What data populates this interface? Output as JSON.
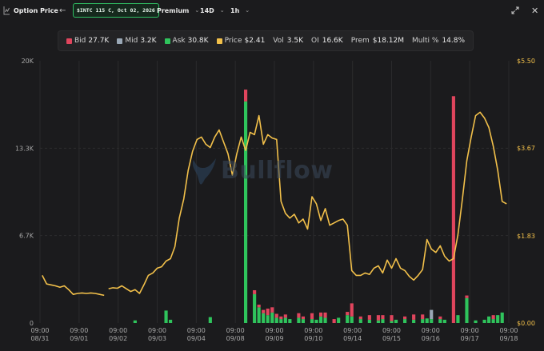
{
  "toolbar": {
    "title": "Option Price",
    "back_icon": "arrow-left-icon",
    "ticker": "$INTC 115 C, Oct 02, 2026",
    "dropdowns": [
      "Premium",
      "14D",
      "1h"
    ],
    "expand_icon": "expand-icon",
    "close_icon": "close-icon"
  },
  "legend": {
    "bid": {
      "label": "Bid",
      "value": "27.7K",
      "color": "#e0455d"
    },
    "mid": {
      "label": "Mid",
      "value": "3.2K",
      "color": "#9aa8b6"
    },
    "ask": {
      "label": "Ask",
      "value": "30.8K",
      "color": "#2fc45c"
    },
    "price": {
      "label": "Price",
      "value": "$2.41",
      "color": "#f2c04a"
    },
    "vol": {
      "label": "Vol",
      "value": "3.5K"
    },
    "oi": {
      "label": "OI",
      "value": "16.6K"
    },
    "prem": {
      "label": "Prem",
      "value": "$18.12M"
    },
    "multi": {
      "label": "Multi %",
      "value": "14.8%"
    }
  },
  "watermark": "Bullflow",
  "chart_data": {
    "type": "bar+line",
    "left_axis": {
      "ticks": [
        "20K",
        "13.3K",
        "6.7K",
        "0"
      ],
      "ylim": [
        0,
        20000
      ]
    },
    "right_axis": {
      "ticks": [
        "$5.50",
        "$3.67",
        "$1.83",
        "$0.00"
      ],
      "ylim": [
        0,
        5.5
      ]
    },
    "x_ticks": [
      [
        "09:00",
        "08/31"
      ],
      [
        "09:00",
        "09/01"
      ],
      [
        "09:00",
        "09/02"
      ],
      [
        "09:00",
        "09/03"
      ],
      [
        "09:00",
        "09/04"
      ],
      [
        "09:00",
        "09/08"
      ],
      [
        "09:00",
        "09/09"
      ],
      [
        "09:00",
        "09/10"
      ],
      [
        "09:00",
        "09/14"
      ],
      [
        "09:00",
        "09/15"
      ],
      [
        "09:00",
        "09/16"
      ],
      [
        "09:00",
        "09/17"
      ],
      [
        "09:00",
        "09/18"
      ]
    ],
    "colors": {
      "bid": "#e0455d",
      "mid": "#9aa8b6",
      "ask": "#2fc45c",
      "price": "#f2c04a"
    },
    "price_series": [
      [
        0,
        1.0
      ],
      [
        1,
        0.82
      ],
      [
        2,
        0.8
      ],
      [
        3,
        0.78
      ],
      [
        4,
        0.75
      ],
      [
        5,
        0.78
      ],
      [
        6,
        0.7
      ],
      [
        7,
        0.6
      ],
      [
        8,
        0.62
      ],
      [
        9,
        0.63
      ],
      [
        10,
        0.62
      ],
      [
        11,
        0.63
      ],
      [
        12,
        0.62
      ],
      [
        13,
        0.6
      ],
      [
        14,
        0.58
      ],
      [
        15,
        0.72
      ],
      [
        16,
        0.74
      ],
      [
        17,
        0.73
      ],
      [
        18,
        0.78
      ],
      [
        19,
        0.72
      ],
      [
        20,
        0.66
      ],
      [
        21,
        0.7
      ],
      [
        22,
        0.62
      ],
      [
        23,
        0.8
      ],
      [
        24,
        1.0
      ],
      [
        25,
        1.05
      ],
      [
        26,
        1.15
      ],
      [
        27,
        1.18
      ],
      [
        28,
        1.3
      ],
      [
        29,
        1.35
      ],
      [
        30,
        1.6
      ],
      [
        31,
        2.2
      ],
      [
        32,
        2.6
      ],
      [
        33,
        3.2
      ],
      [
        34,
        3.6
      ],
      [
        35,
        3.85
      ],
      [
        36,
        3.9
      ],
      [
        37,
        3.75
      ],
      [
        38,
        3.68
      ],
      [
        39,
        3.9
      ],
      [
        40,
        4.05
      ],
      [
        41,
        3.8
      ],
      [
        42,
        3.55
      ],
      [
        43,
        3.1
      ],
      [
        44,
        3.55
      ],
      [
        45,
        3.9
      ],
      [
        46,
        3.62
      ],
      [
        47,
        4.0
      ],
      [
        48,
        3.95
      ],
      [
        49,
        4.35
      ],
      [
        50,
        3.75
      ],
      [
        51,
        3.95
      ],
      [
        52,
        3.88
      ],
      [
        53,
        3.85
      ],
      [
        54,
        2.55
      ],
      [
        55,
        2.3
      ],
      [
        56,
        2.2
      ],
      [
        57,
        2.28
      ],
      [
        58,
        2.1
      ],
      [
        59,
        2.18
      ],
      [
        60,
        1.97
      ],
      [
        61,
        2.65
      ],
      [
        62,
        2.5
      ],
      [
        63,
        2.15
      ],
      [
        64,
        2.4
      ],
      [
        65,
        2.05
      ],
      [
        66,
        2.1
      ],
      [
        67,
        2.15
      ],
      [
        68,
        2.18
      ],
      [
        69,
        2.05
      ],
      [
        70,
        1.1
      ],
      [
        71,
        1.0
      ],
      [
        72,
        1.0
      ],
      [
        73,
        1.05
      ],
      [
        74,
        1.02
      ],
      [
        75,
        1.15
      ],
      [
        76,
        1.2
      ],
      [
        77,
        1.05
      ],
      [
        78,
        1.32
      ],
      [
        79,
        1.15
      ],
      [
        80,
        1.35
      ],
      [
        81,
        1.15
      ],
      [
        82,
        1.1
      ],
      [
        83,
        0.98
      ],
      [
        84,
        0.9
      ],
      [
        85,
        1.0
      ],
      [
        86,
        1.12
      ],
      [
        87,
        1.75
      ],
      [
        88,
        1.55
      ],
      [
        89,
        1.48
      ],
      [
        90,
        1.62
      ],
      [
        91,
        1.4
      ],
      [
        92,
        1.3
      ],
      [
        93,
        1.35
      ],
      [
        94,
        1.85
      ],
      [
        95,
        2.6
      ],
      [
        96,
        3.4
      ],
      [
        97,
        3.9
      ],
      [
        98,
        4.35
      ],
      [
        99,
        4.42
      ],
      [
        100,
        4.3
      ],
      [
        101,
        4.1
      ],
      [
        102,
        3.7
      ],
      [
        103,
        3.2
      ],
      [
        104,
        2.55
      ],
      [
        105,
        2.5
      ]
    ],
    "volume_bars": [
      {
        "x": 21,
        "bid": 0,
        "mid": 0,
        "ask": 200
      },
      {
        "x": 28,
        "bid": 0,
        "mid": 0,
        "ask": 950
      },
      {
        "x": 29,
        "bid": 0,
        "mid": 0,
        "ask": 250
      },
      {
        "x": 38,
        "bid": 0,
        "mid": 0,
        "ask": 450
      },
      {
        "x": 46,
        "bid": 900,
        "mid": 0,
        "ask": 16900
      },
      {
        "x": 48,
        "bid": 300,
        "mid": 0,
        "ask": 2200
      },
      {
        "x": 49,
        "bid": 200,
        "mid": 0,
        "ask": 1200
      },
      {
        "x": 50,
        "bid": 250,
        "mid": 0,
        "ask": 750
      },
      {
        "x": 51,
        "bid": 500,
        "mid": 0,
        "ask": 600
      },
      {
        "x": 52,
        "bid": 400,
        "mid": 0,
        "ask": 800
      },
      {
        "x": 53,
        "bid": 300,
        "mid": 0,
        "ask": 400
      },
      {
        "x": 54,
        "bid": 200,
        "mid": 0,
        "ask": 300
      },
      {
        "x": 55,
        "bid": 250,
        "mid": 0,
        "ask": 400
      },
      {
        "x": 56,
        "bid": 0,
        "mid": 0,
        "ask": 300
      },
      {
        "x": 58,
        "bid": 350,
        "mid": 0,
        "ask": 400
      },
      {
        "x": 59,
        "bid": 200,
        "mid": 0,
        "ask": 300
      },
      {
        "x": 61,
        "bid": 450,
        "mid": 0,
        "ask": 300
      },
      {
        "x": 62,
        "bid": 0,
        "mid": 0,
        "ask": 250
      },
      {
        "x": 63,
        "bid": 300,
        "mid": 0,
        "ask": 500
      },
      {
        "x": 64,
        "bid": 400,
        "mid": 0,
        "ask": 400
      },
      {
        "x": 66,
        "bid": 300,
        "mid": 0,
        "ask": 0
      },
      {
        "x": 67,
        "bid": 0,
        "mid": 0,
        "ask": 400
      },
      {
        "x": 69,
        "bid": 250,
        "mid": 0,
        "ask": 600
      },
      {
        "x": 70,
        "bid": 1000,
        "mid": 0,
        "ask": 500
      },
      {
        "x": 72,
        "bid": 200,
        "mid": 0,
        "ask": 300
      },
      {
        "x": 74,
        "bid": 350,
        "mid": 0,
        "ask": 250
      },
      {
        "x": 76,
        "bid": 400,
        "mid": 0,
        "ask": 200
      },
      {
        "x": 77,
        "bid": 300,
        "mid": 0,
        "ask": 300
      },
      {
        "x": 79,
        "bid": 450,
        "mid": 0,
        "ask": 150
      },
      {
        "x": 80,
        "bid": 0,
        "mid": 0,
        "ask": 250
      },
      {
        "x": 82,
        "bid": 200,
        "mid": 0,
        "ask": 300
      },
      {
        "x": 84,
        "bid": 400,
        "mid": 0,
        "ask": 250
      },
      {
        "x": 86,
        "bid": 350,
        "mid": 0,
        "ask": 300
      },
      {
        "x": 87,
        "bid": 0,
        "mid": 0,
        "ask": 350
      },
      {
        "x": 88,
        "bid": 0,
        "mid": 700,
        "ask": 300
      },
      {
        "x": 90,
        "bid": 200,
        "mid": 0,
        "ask": 300
      },
      {
        "x": 91,
        "bid": 0,
        "mid": 0,
        "ask": 250
      },
      {
        "x": 93,
        "bid": 17300,
        "mid": 0,
        "ask": 0
      },
      {
        "x": 94,
        "bid": 0,
        "mid": 0,
        "ask": 600
      },
      {
        "x": 96,
        "bid": 200,
        "mid": 0,
        "ask": 1900
      },
      {
        "x": 98,
        "bid": 0,
        "mid": 0,
        "ask": 200
      },
      {
        "x": 100,
        "bid": 0,
        "mid": 0,
        "ask": 250
      },
      {
        "x": 101,
        "bid": 0,
        "mid": 0,
        "ask": 500
      },
      {
        "x": 102,
        "bid": 300,
        "mid": 0,
        "ask": 300
      },
      {
        "x": 103,
        "bid": 0,
        "mid": 0,
        "ask": 600
      },
      {
        "x": 104,
        "bid": 0,
        "mid": 0,
        "ask": 800
      }
    ]
  }
}
